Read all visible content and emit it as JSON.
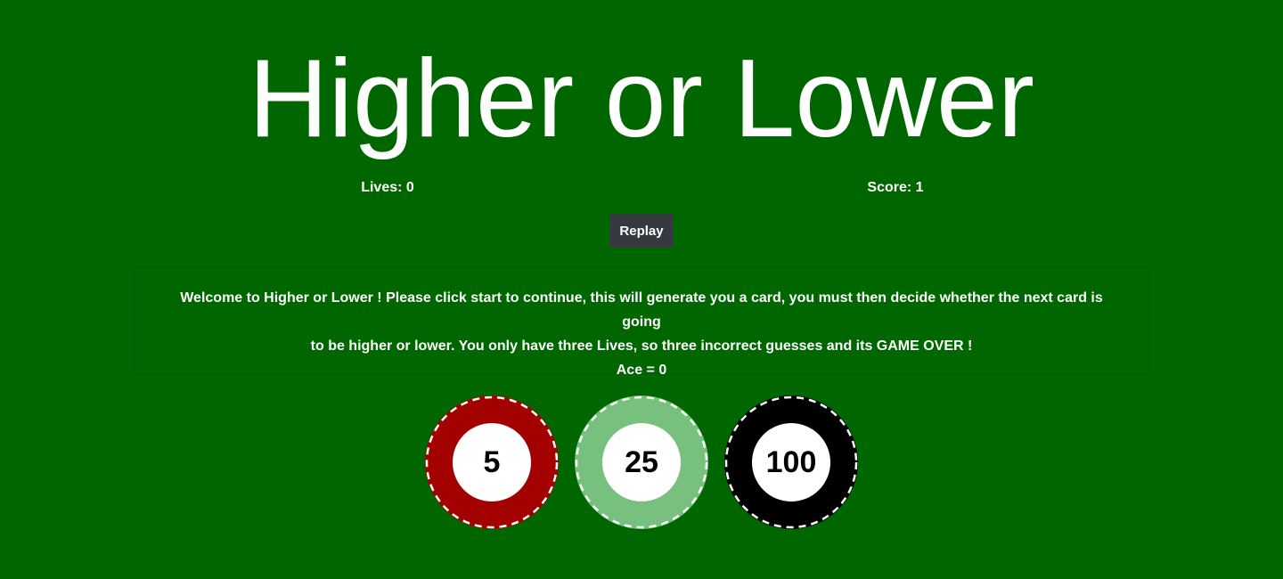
{
  "game": {
    "title": "Higher or Lower",
    "lives_text": "Lives: 0",
    "score_text": "Score: 1",
    "replay_label": "Replay"
  },
  "info": {
    "line1": "Welcome to Higher or Lower ! Please click start to continue, this will generate you a card, you must then decide whether the next card is going",
    "line2": "to be higher or lower. You only have three Lives, so three incorrect guesses and its GAME OVER !",
    "line3": "Ace = 0"
  },
  "chips": [
    {
      "value": "5",
      "color": "#a30000"
    },
    {
      "value": "25",
      "color": "#77c07e"
    },
    {
      "value": "100",
      "color": "#000000"
    }
  ],
  "colors": {
    "background": "#006600",
    "button": "#343a40",
    "text": "#ffffff"
  }
}
